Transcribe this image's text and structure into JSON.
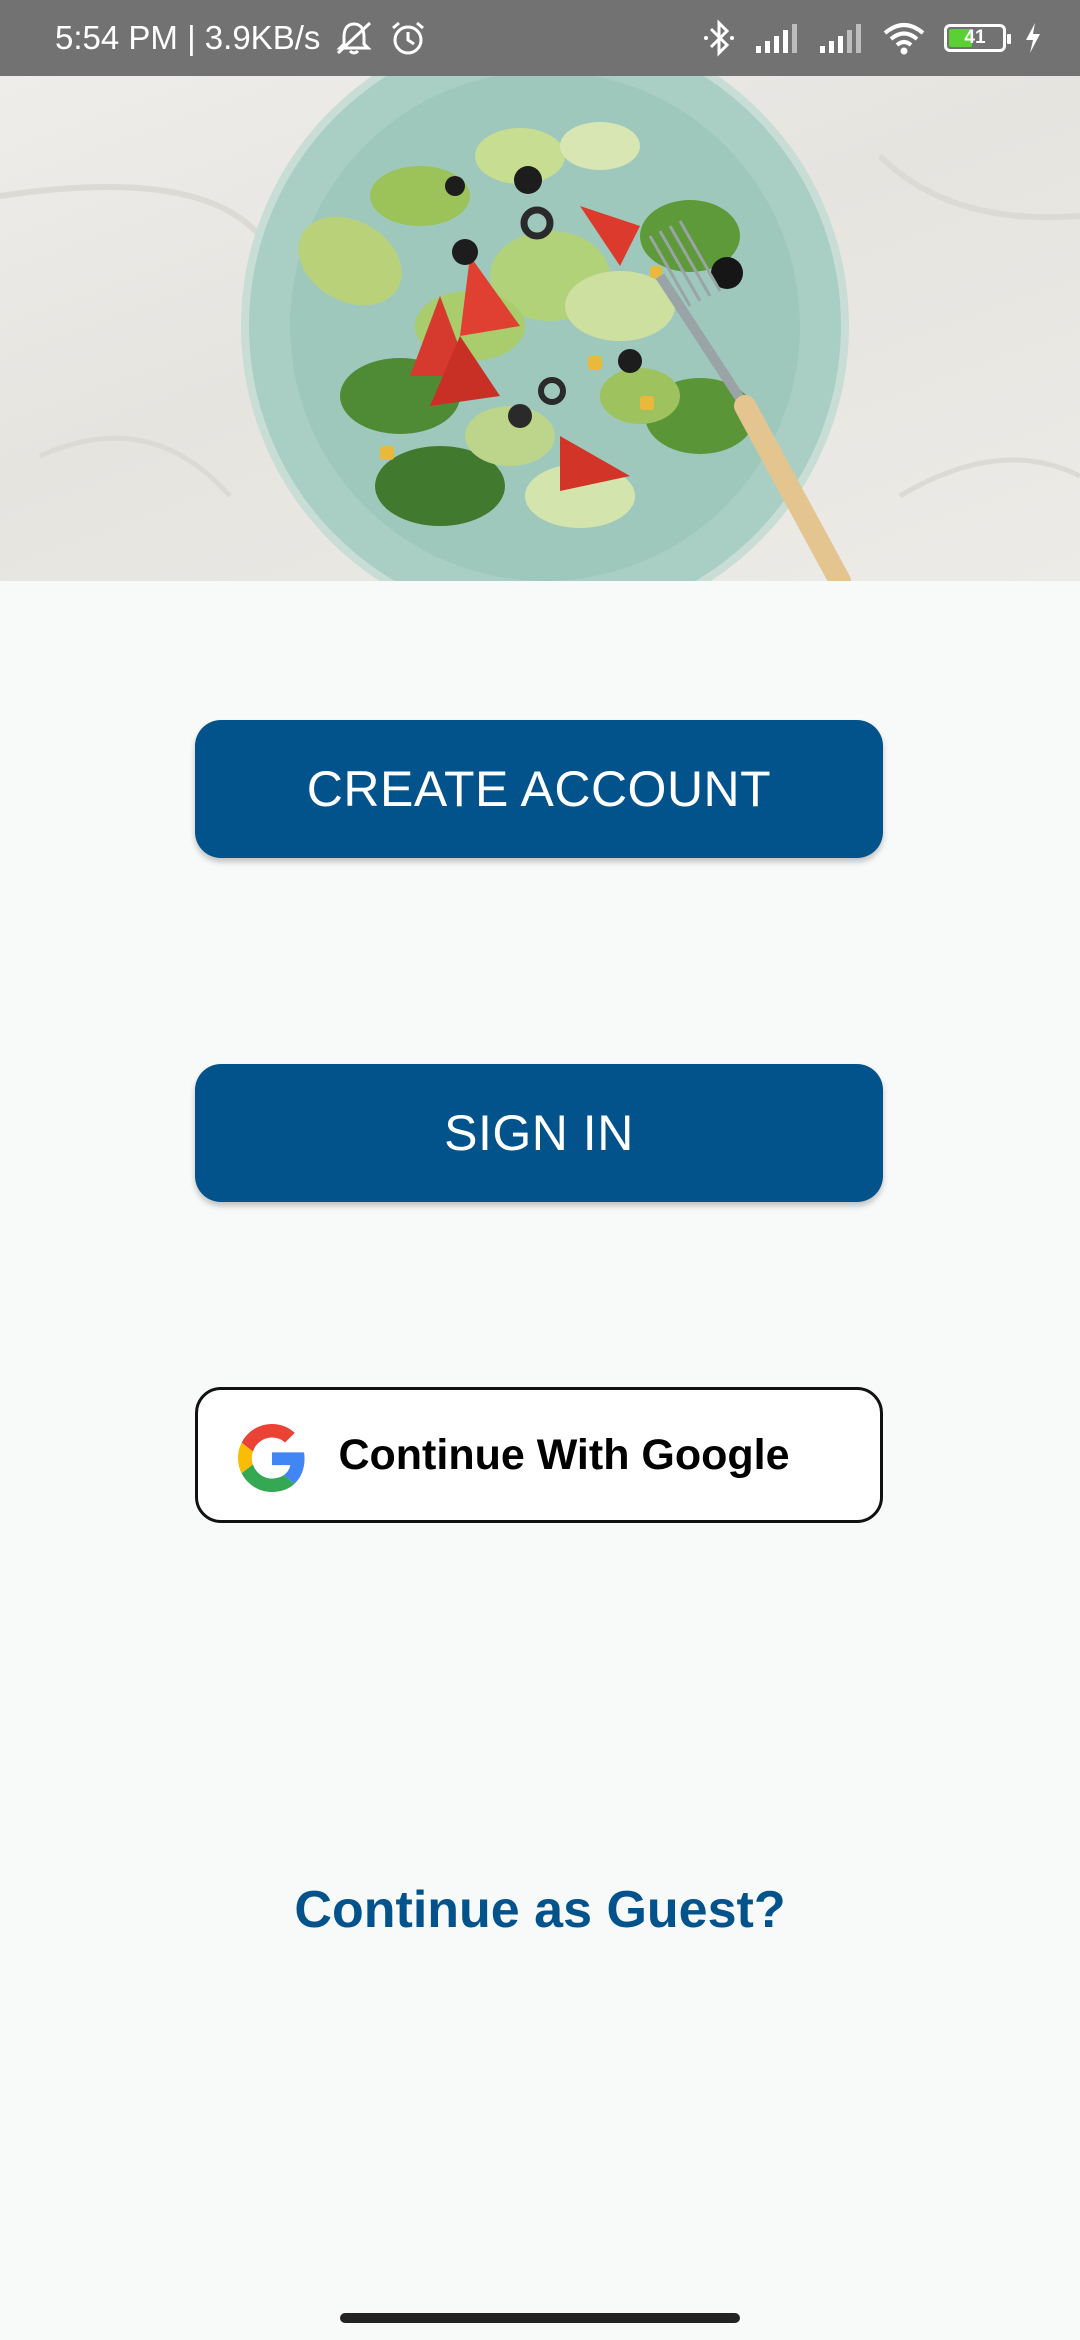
{
  "status_bar": {
    "time_speed": "5:54 PM | 3.9KB/s",
    "battery_level": "41",
    "icons": [
      "muted-bell-icon",
      "alarm-icon",
      "bluetooth-icon",
      "signal-icon",
      "signal-icon",
      "wifi-icon",
      "battery-icon",
      "charging-icon"
    ]
  },
  "hero": {
    "image": "salad-plate-with-fork"
  },
  "buttons": {
    "create_account": "CREATE ACCOUNT",
    "sign_in": "SIGN IN",
    "google": "Continue With Google"
  },
  "guest_link": "Continue as Guest?",
  "colors": {
    "primary": "#02538c",
    "status_bar": "#727272",
    "background": "#f8f9f9"
  }
}
